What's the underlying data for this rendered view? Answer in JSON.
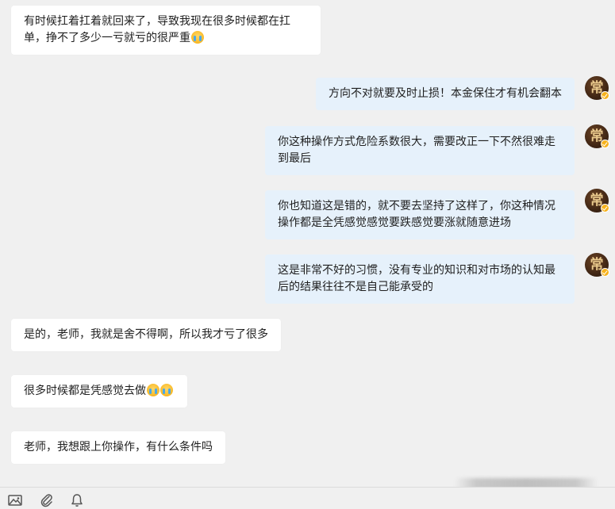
{
  "messages": [
    {
      "side": "left",
      "text": "有时候扛着扛着就回来了，导致我现在很多时候都在扛单，挣不了多少一亏就亏的很严重",
      "emoji": "crying-face"
    },
    {
      "side": "right",
      "text": "方向不对就要及时止损！本金保住才有机会翻本"
    },
    {
      "side": "right",
      "text": "你这种操作方式危险系数很大，需要改正一下不然很难走到最后"
    },
    {
      "side": "right",
      "text": "你也知道这是错的，就不要去坚持了这样了，你这种情况操作都是全凭感觉感觉要跌感觉要涨就随意进场"
    },
    {
      "side": "right",
      "text": "这是非常不好的习惯，没有专业的知识和对市场的认知最后的结果往往不是自己能承受的"
    },
    {
      "side": "left",
      "text": "是的，老师，我就是舍不得啊，所以我才亏了很多"
    },
    {
      "side": "left",
      "text": "很多时候都是凭感觉去做",
      "emoji": "crying-face x2"
    },
    {
      "side": "left",
      "text": "老师，我想跟上你操作，有什么条件吗"
    }
  ],
  "avatar": {
    "glyph": "常",
    "badge_color": "#f6b21c"
  },
  "toolbar": {
    "icons": [
      "image-icon",
      "attachment-icon",
      "bell-icon"
    ]
  },
  "colors": {
    "background": "#f0f0f0",
    "left_bubble": "#ffffff",
    "right_bubble": "#e6f1fb"
  }
}
